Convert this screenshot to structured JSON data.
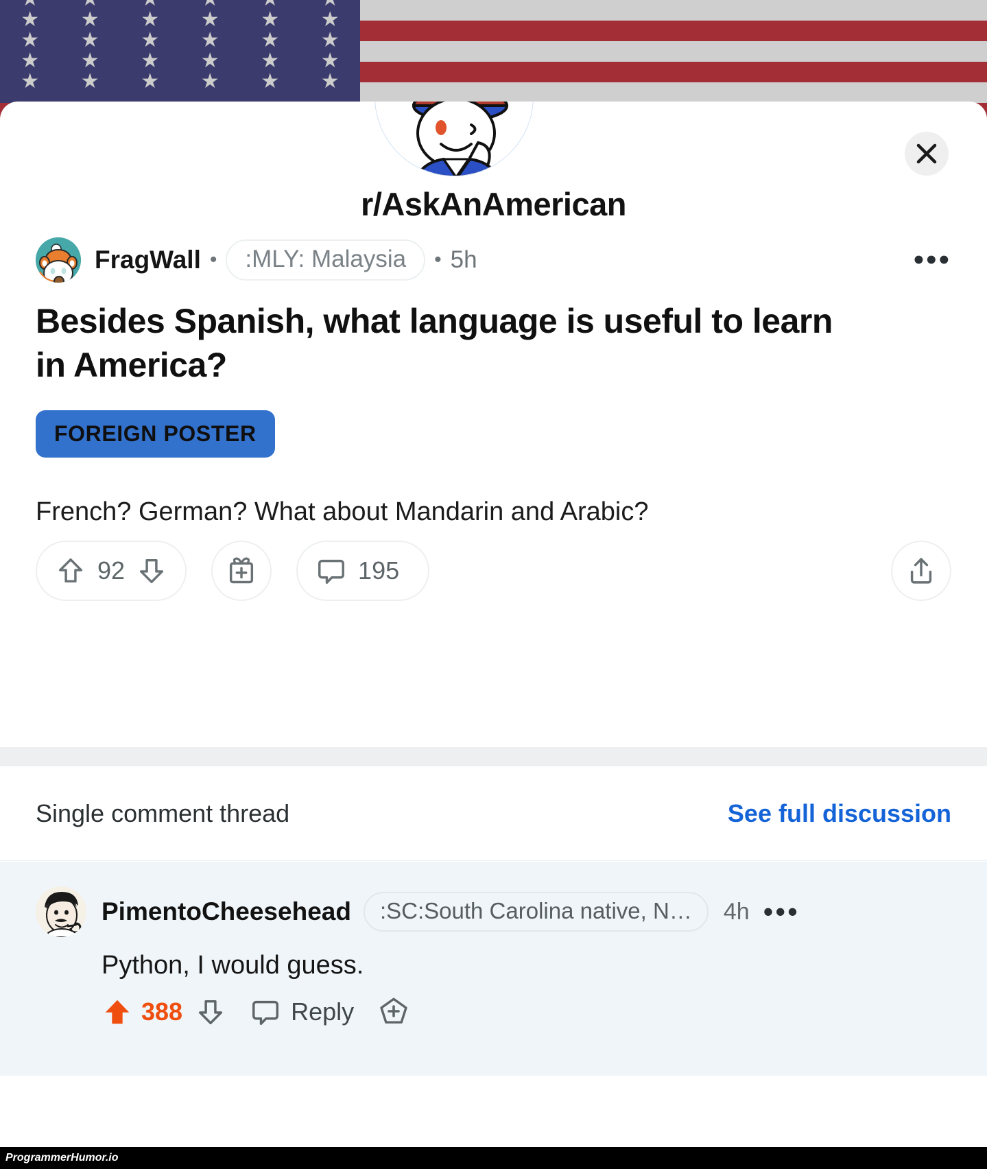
{
  "banner": {
    "flag_navy": "#3b3b6d",
    "flag_red": "#a32e35",
    "flag_white": "#cfcfcf",
    "star_rows": 5,
    "stars_per_row": 6
  },
  "header": {
    "subreddit": "r/AskAnAmerican",
    "avatar_name": "uncle-sam-snoo-avatar",
    "close_label": "✕"
  },
  "post": {
    "author": "FragWall",
    "separator": "•",
    "flair": ":MLY: Malaysia",
    "age": "5h",
    "overflow": "•••",
    "title": "Besides Spanish, what language is useful to learn in America?",
    "badge": "FOREIGN POSTER",
    "badge_color": "#3271cc",
    "body": "French? German? What about Mandarin and Arabic?",
    "actions": {
      "upvote_icon": "upvote-arrow-icon",
      "score": "92",
      "downvote_icon": "downvote-arrow-icon",
      "award_icon": "gift-award-icon",
      "comment_icon": "comment-bubble-icon",
      "comment_count": "195",
      "share_icon": "share-icon"
    }
  },
  "thread": {
    "label": "Single comment thread",
    "link": "See full discussion",
    "link_color": "#1464d8"
  },
  "comment": {
    "author": "PimentoCheesehead",
    "flair": ":SC:South Carolina native, N…",
    "age": "4h",
    "overflow": "•••",
    "body": "Python, I would guess.",
    "score": "388",
    "score_color": "#ef4e0e",
    "reply_label": "Reply",
    "upvote_icon": "upvote-arrow-filled-icon",
    "downvote_icon": "downvote-arrow-icon",
    "reply_icon": "comment-bubble-icon",
    "add_icon": "plus-badge-icon",
    "background": "#f0f5f9"
  },
  "footer": {
    "watermark": "ProgrammerHumor.io"
  }
}
